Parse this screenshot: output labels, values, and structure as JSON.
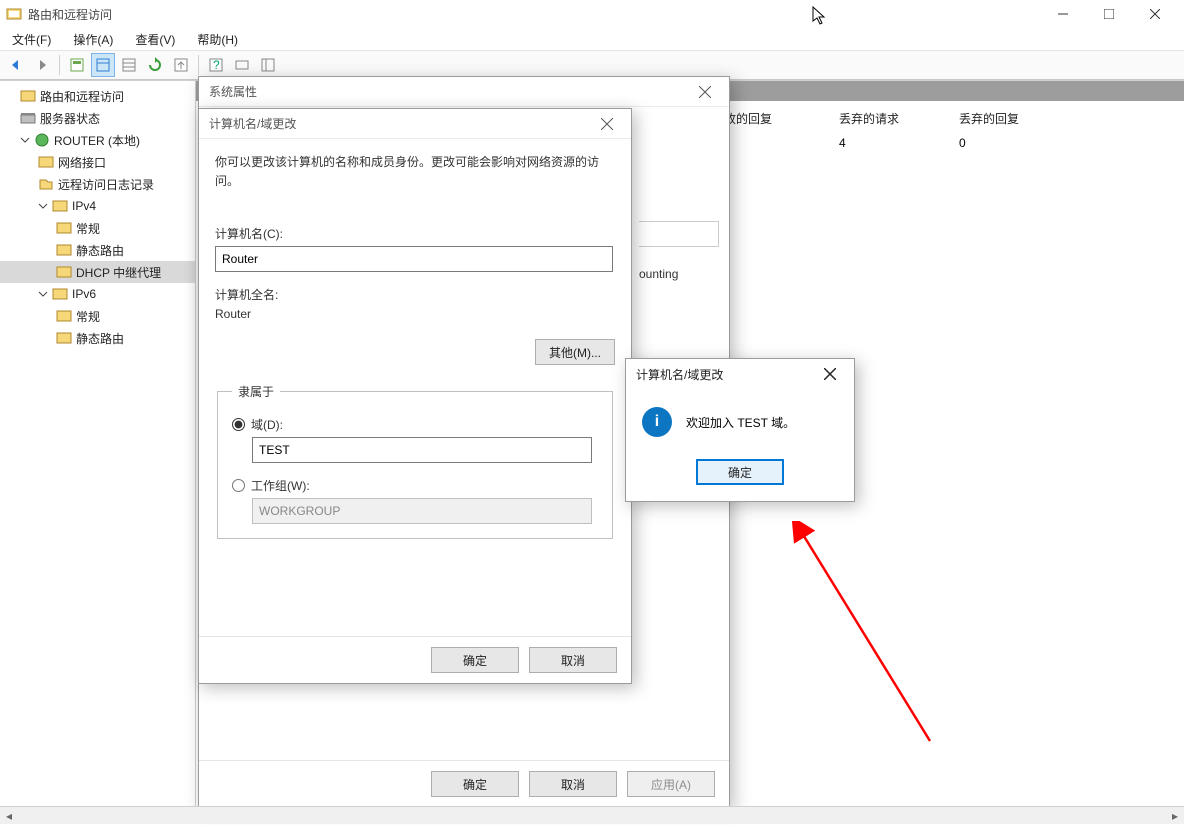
{
  "window": {
    "title": "路由和远程访问",
    "minimize": "—",
    "maximize": "❐",
    "close": "✕"
  },
  "menu": {
    "file": "文件(F)",
    "action": "操作(A)",
    "view": "查看(V)",
    "help": "帮助(H)"
  },
  "tree": {
    "root": "路由和远程访问",
    "server_status": "服务器状态",
    "router": "ROUTER (本地)",
    "net_if": "网络接口",
    "remote_log": "远程访问日志记录",
    "ipv4": "IPv4",
    "general": "常规",
    "static_route": "静态路由",
    "dhcp_relay": "DHCP 中继代理",
    "ipv6": "IPv6"
  },
  "grid": {
    "col_recv_reply": "收的回复",
    "col_drop_req": "丢弃的请求",
    "col_drop_reply": "丢弃的回复",
    "val_drop_req": "4",
    "val_drop_reply": "0"
  },
  "sysprops": {
    "title": "系统属性",
    "ok": "确定",
    "cancel": "取消",
    "apply": "应用(A)",
    "partial_accounting": "ounting"
  },
  "rename": {
    "title": "计算机名/域更改",
    "desc": "你可以更改该计算机的名称和成员身份。更改可能会影响对网络资源的访问。",
    "name_label": "计算机名(C):",
    "name_value": "Router",
    "fullname_label": "计算机全名:",
    "fullname_value": "Router",
    "other": "其他(M)...",
    "member_of": "隶属于",
    "domain_label": "域(D):",
    "domain_value": "TEST",
    "workgroup_label": "工作组(W):",
    "workgroup_value": "WORKGROUP",
    "ok": "确定",
    "cancel": "取消"
  },
  "msgbox": {
    "title": "计算机名/域更改",
    "text": "欢迎加入 TEST 域。",
    "ok": "确定"
  }
}
